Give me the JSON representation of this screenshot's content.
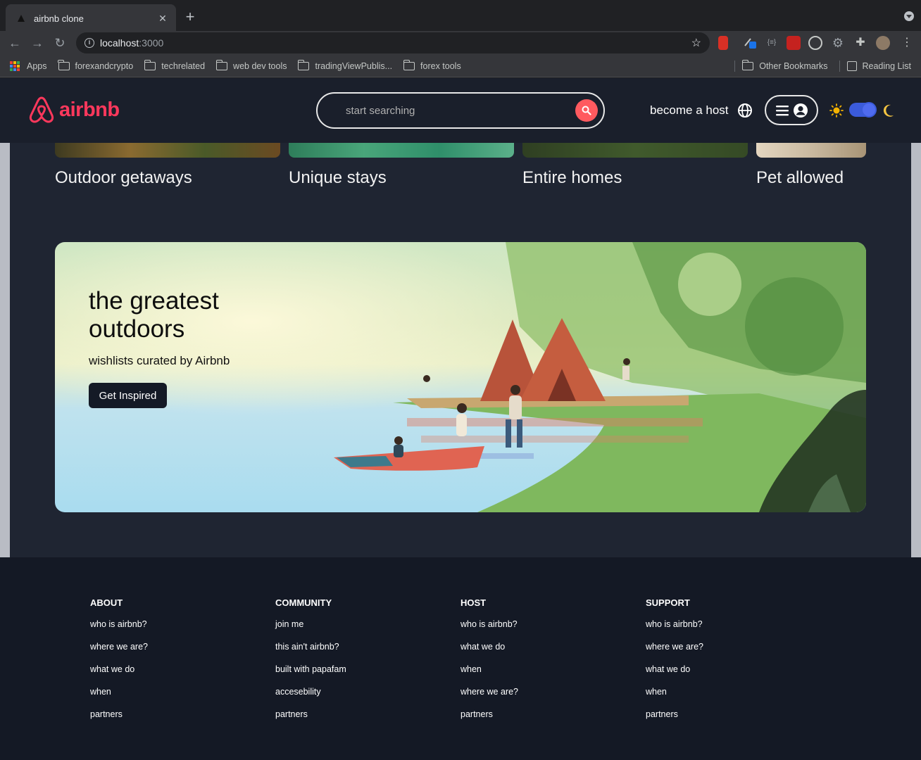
{
  "browser": {
    "tab_title": "airbnb clone",
    "url_host": "localhost",
    "url_port": ":3000",
    "bookmarks": [
      {
        "label": "Apps",
        "type": "apps"
      },
      {
        "label": "forexandcrypto",
        "type": "folder"
      },
      {
        "label": "techrelated",
        "type": "folder"
      },
      {
        "label": "web dev tools",
        "type": "folder"
      },
      {
        "label": "tradingViewPublis...",
        "type": "folder"
      },
      {
        "label": "forex tools",
        "type": "folder"
      }
    ],
    "other_bookmarks": "Other Bookmarks",
    "reading_list": "Reading List"
  },
  "header": {
    "logo_text": "airbnb",
    "search_placeholder": "start searching",
    "become_host": "become a host",
    "brand_color": "#ff385c"
  },
  "cards": [
    {
      "title": "Outdoor getaways",
      "color": "#6b5a2e"
    },
    {
      "title": "Unique stays",
      "color": "#2f8f6a"
    },
    {
      "title": "Entire homes",
      "color": "#3a4d2a"
    },
    {
      "title": "Pet allowed",
      "color": "#c9b9a0"
    }
  ],
  "hero": {
    "title": "the greatest outdoors",
    "subtitle": "wishlists curated by Airbnb",
    "button": "Get Inspired"
  },
  "footer": {
    "columns": [
      {
        "heading": "ABOUT",
        "links": [
          "who is airbnb?",
          "where we are?",
          "what we do",
          "when",
          "partners"
        ]
      },
      {
        "heading": "COMMUNITY",
        "links": [
          "join me",
          "this ain't airbnb?",
          "built with papafam",
          "accesebility",
          "partners"
        ]
      },
      {
        "heading": "HOST",
        "links": [
          "who is airbnb?",
          "what we do",
          "when",
          "where we are?",
          "partners"
        ]
      },
      {
        "heading": "SUPPORT",
        "links": [
          "who is airbnb?",
          "where we are?",
          "what we do",
          "when",
          "partners"
        ]
      }
    ]
  }
}
